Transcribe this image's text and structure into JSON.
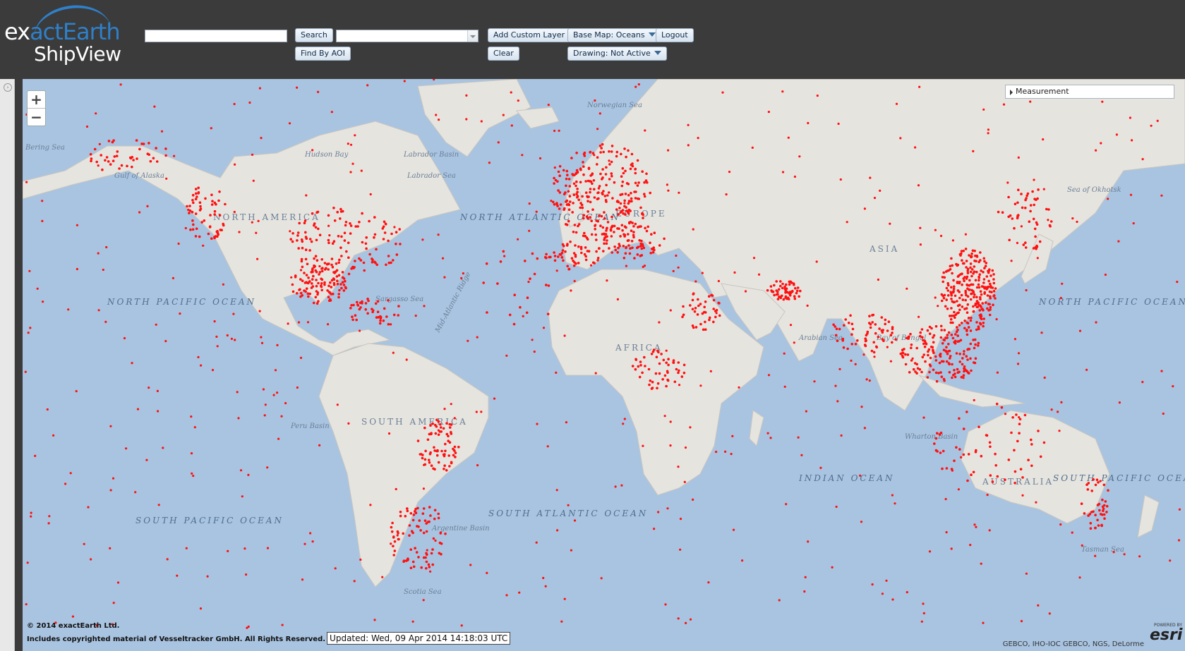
{
  "logo": {
    "line1_a": "ex",
    "line1_b": "act",
    "line1_c": "Earth",
    "line2": "ShipView"
  },
  "toolbar": {
    "search_value": "",
    "search_label": "Search",
    "layer_combo_value": "",
    "add_custom_layer_label": "Add Custom Layer",
    "base_map_label": "Base Map: Oceans",
    "logout_label": "Logout",
    "find_by_aoi_label": "Find By AOI",
    "clear_label": "Clear",
    "drawing_label": "Drawing: Not Active"
  },
  "map": {
    "zoom_in": "+",
    "zoom_out": "−",
    "measurement_label": "Measurement",
    "ocean_color": "#a9c4e1",
    "land_color": "#e6e4df",
    "ship_color": "#ff1111",
    "labels": {
      "north_america": "NORTH AMERICA",
      "south_america": "SOUTH AMERICA",
      "europe": "EUROPE",
      "africa": "AFRICA",
      "asia": "ASIA",
      "australia": "AUSTRALIA",
      "north_atlantic": "NORTH ATLANTIC OCEAN",
      "south_atlantic": "SOUTH ATLANTIC OCEAN",
      "north_pacific": "NORTH PACIFIC OCEAN",
      "south_pacific": "SOUTH PACIFIC OCEAN",
      "north_pacific_east": "NORTH PACIFIC OCEAN",
      "south_pacific_east": "SOUTH PACIFIC OCEAN",
      "indian_ocean": "INDIAN OCEAN",
      "hudson_bay": "Hudson Bay",
      "labrador_basin": "Labrador Basin",
      "labrador_sea": "Labrador Sea",
      "gulf_alaska": "Gulf of Alaska",
      "bering_sea": "Bering Sea",
      "norwegian_sea": "Norwegian Sea",
      "arabian_sea": "Arabian Sea",
      "bay_bengal": "Bay of Bengal",
      "peru_basin": "Peru Basin",
      "argentine_basin": "Argentine Basin",
      "wharton_basin": "Wharton Basin",
      "sargasso_sea": "Sargasso Sea",
      "mid_atlantic_ridge": "Mid-Atlantic Ridge",
      "sea_okhotsk": "Sea of Okhotsk",
      "scotia_sea": "Scotia Sea",
      "tasman_sea": "Tasman Sea"
    },
    "copyright_line1": "© 2014 exactEarth Ltd.",
    "copyright_line2": "Includes copyrighted material of Vesseltracker GmbH. All Rights Reserved.",
    "updated": "Updated: Wed, 09 Apr 2014 14:18:03 UTC",
    "attribution": "GEBCO, IHO-IOC GEBCO, NGS, DeLorme",
    "esri_powered": "POWERED BY",
    "esri_logo": "esri"
  }
}
